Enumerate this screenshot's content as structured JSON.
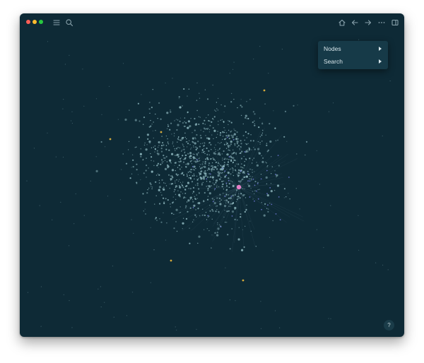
{
  "window": {
    "background": "#0e2a36",
    "traffic_lights": [
      "#ff5f57",
      "#febc2e",
      "#28c840"
    ]
  },
  "toolbar_left": [
    {
      "icon": "menu-icon"
    },
    {
      "icon": "search-icon"
    }
  ],
  "toolbar_right": [
    {
      "icon": "home-icon"
    },
    {
      "icon": "arrow-left-icon"
    },
    {
      "icon": "arrow-right-icon"
    },
    {
      "icon": "more-icon"
    },
    {
      "icon": "sidebar-icon"
    }
  ],
  "menu": {
    "items": [
      {
        "label": "Nodes"
      },
      {
        "label": "Search"
      }
    ]
  },
  "help": {
    "label": "?"
  },
  "graph": {
    "node_color": "#8fb8bf",
    "accent_colors": {
      "hub": "#e77fc8",
      "highlight": "#e0b13c",
      "linked": "#6f79d6"
    }
  }
}
